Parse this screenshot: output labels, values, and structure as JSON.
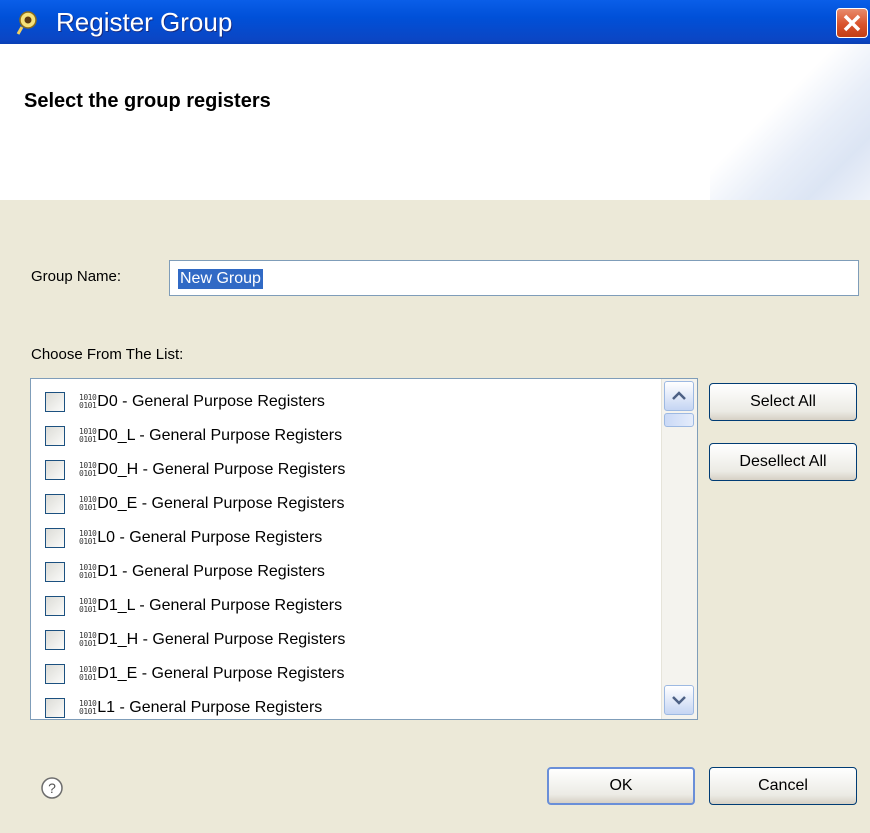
{
  "window": {
    "title": "Register Group"
  },
  "header": {
    "title": "Select the group registers"
  },
  "form": {
    "group_name_label": "Group Name:",
    "group_name_value": "New Group",
    "list_label": "Choose From The List:"
  },
  "register_icon_lines": [
    "1010",
    "0101"
  ],
  "list_items": [
    {
      "label": "D0 - General Purpose Registers",
      "checked": false
    },
    {
      "label": "D0_L - General Purpose Registers",
      "checked": false
    },
    {
      "label": "D0_H - General Purpose Registers",
      "checked": false
    },
    {
      "label": "D0_E - General Purpose Registers",
      "checked": false
    },
    {
      "label": "L0 - General Purpose Registers",
      "checked": false
    },
    {
      "label": "D1 - General Purpose Registers",
      "checked": false
    },
    {
      "label": "D1_L - General Purpose Registers",
      "checked": false
    },
    {
      "label": "D1_H - General Purpose Registers",
      "checked": false
    },
    {
      "label": "D1_E - General Purpose Registers",
      "checked": false
    },
    {
      "label": "L1 - General Purpose Registers",
      "checked": false
    }
  ],
  "buttons": {
    "select_all": "Select All",
    "deselect_all": "Desellect All",
    "ok": "OK",
    "cancel": "Cancel"
  },
  "icons": {
    "app": "register-group-icon",
    "close": "close-icon",
    "help": "help-icon",
    "scroll_up": "scroll-up-icon",
    "scroll_down": "scroll-down-icon"
  },
  "colors": {
    "titlebar": "#0050d8",
    "close_button": "#d9532c",
    "dialog_background": "#ece9d8",
    "selection": "#316ac5"
  }
}
